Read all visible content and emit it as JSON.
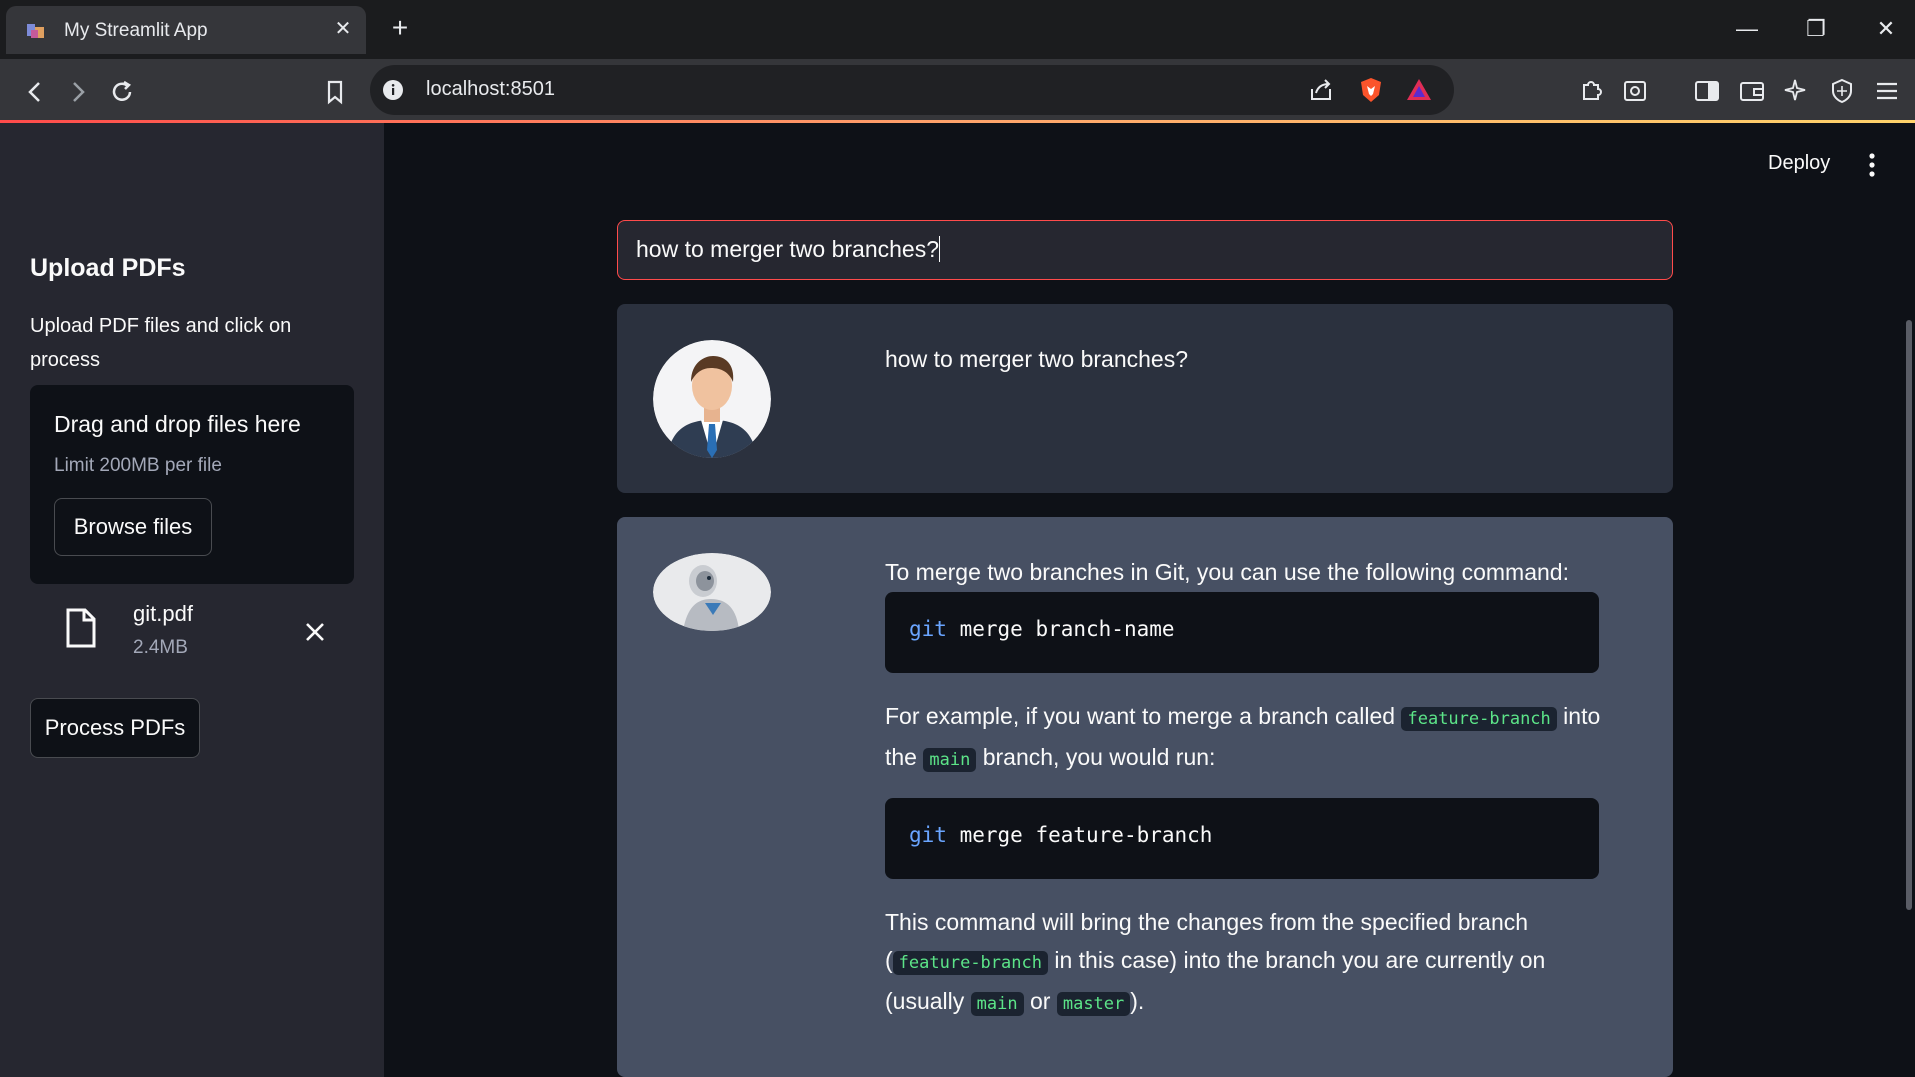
{
  "browser": {
    "tab_title": "My Streamlit App",
    "url": "localhost:8501"
  },
  "sidebar": {
    "title": "Upload PDFs",
    "description": "Upload PDF files and click on process",
    "uploader": {
      "title": "Drag and drop files here",
      "limit": "Limit 200MB per file",
      "browse_label": "Browse files"
    },
    "file": {
      "name": "git.pdf",
      "size": "2.4MB"
    },
    "process_label": "Process PDFs"
  },
  "header": {
    "deploy_label": "Deploy"
  },
  "chat": {
    "input_value": "how to merger two branches?",
    "user_message": "how to merger two branches?",
    "bot": {
      "intro": "To merge two branches in Git, you can use the following command:",
      "code1_kw": "git",
      "code1_rest": " merge branch-name",
      "p2_a": "For example, if you want to merge a branch called ",
      "p2_code1": "feature-branch",
      "p2_b": " into the ",
      "p2_code2": "main",
      "p2_c": " branch, you would run:",
      "code2_kw": "git",
      "code2_rest": " merge feature-branch",
      "p3_a": "This command will bring the changes from the specified branch (",
      "p3_code1": "feature-branch",
      "p3_b": " in this case) into the branch you are currently on (usually ",
      "p3_code2": "main",
      "p3_c": " or ",
      "p3_code3": "master",
      "p3_d": ")."
    }
  },
  "icons": {
    "back": "back-icon",
    "forward": "forward-icon",
    "reload": "reload-icon",
    "bookmark": "bookmark-icon",
    "share": "share-icon",
    "brave": "brave-shield-icon",
    "rewards": "brave-rewards-icon",
    "extensions": "extensions-icon",
    "sidebar": "sidebar-icon",
    "wallet": "wallet-icon",
    "leo": "leo-ai-icon",
    "vpn": "vpn-icon",
    "menu": "menu-icon"
  },
  "colors": {
    "accent": "#ff4b4b",
    "code_keyword": "#6aa5ff",
    "inline_code": "#5ce488",
    "bot_bg": "#475063",
    "user_bg": "#2b313e"
  }
}
